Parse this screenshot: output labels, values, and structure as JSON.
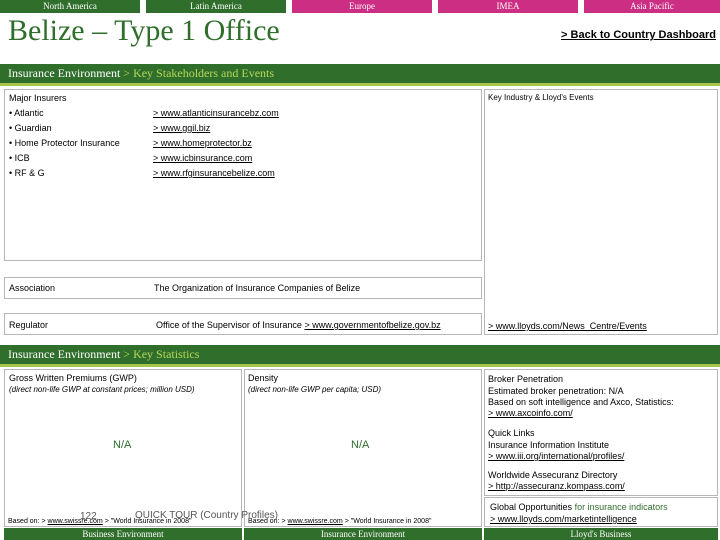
{
  "nav": {
    "tabs": [
      "North America",
      "Latin America",
      "Europe",
      "IMEA",
      "Asia Pacific"
    ]
  },
  "header": {
    "title": "Belize – Type 1 Office",
    "back_link": "> Back to Country Dashboard"
  },
  "section1": {
    "title": "Insurance Environment",
    "sub": "> Key Stakeholders and Events"
  },
  "major_insurers": {
    "heading": "Major Insurers",
    "items": [
      {
        "name": "• Atlantic",
        "url": "> www.atlanticinsurancebz.com"
      },
      {
        "name": "• Guardian",
        "url": "> www.ggil.biz"
      },
      {
        "name": "• Home Protector Insurance",
        "url": "> www.homeprotector.bz"
      },
      {
        "name": "• ICB",
        "url": "> www.icbinsurance.com"
      },
      {
        "name": "• RF & G",
        "url": "> www.rfginsurancebelize.com"
      }
    ]
  },
  "events": {
    "heading": "Key Industry & Lloyd's Events",
    "link": "> www.lloyds.com/News_Centre/Events"
  },
  "association": {
    "label": "Association",
    "value": "The Organization of Insurance Companies of Belize"
  },
  "regulator": {
    "label": "Regulator",
    "value": "Office of the Supervisor of Insurance",
    "link": "> www.governmentofbelize.gov.bz"
  },
  "section2": {
    "title": "Insurance Environment",
    "sub": "> Key Statistics"
  },
  "gwp": {
    "heading": "Gross Written Premiums (GWP)",
    "note": "(direct non-life GWP at constant prices; million USD)",
    "value": "N/A",
    "source_prefix": "Based on: >",
    "source_link": "www.swissre.com",
    "source_suffix": "> \"World Insurance in 2008\""
  },
  "density": {
    "heading": "Density",
    "note": "(direct non-life GWP per capita; USD)",
    "value": "N/A",
    "source_prefix": "Based on: >",
    "source_link": "www.swissre.com",
    "source_suffix": "> \"World Insurance in 2008\""
  },
  "page_overlay": {
    "number": "122",
    "label": "QUICK TOUR (Country Profiles)"
  },
  "broker": {
    "heading": "Broker Penetration",
    "line1": "Estimated broker penetration: N/A",
    "line2": "Based on soft intelligence and Axco, Statistics:",
    "link": "> www.axcoinfo.com/"
  },
  "quick_links": {
    "heading": "Quick Links",
    "line1": "Insurance Information Institute",
    "link1": "> www.iii.org/international/profiles/",
    "line2": "Worldwide Assecuranz Directory",
    "link2": "> http://assecuranz.kompass.com/"
  },
  "global": {
    "text": "Global Opportunities",
    "accent": "for insurance indicators",
    "link": "> www.lloyds.com/marketintelligence"
  },
  "footer": {
    "tabs": [
      "Business Environment",
      "Insurance Environment",
      "Lloyd's Business"
    ]
  },
  "colors": {
    "green": "#2f6e2b",
    "magenta": "#cc2e83",
    "lime": "#a9c44a"
  }
}
